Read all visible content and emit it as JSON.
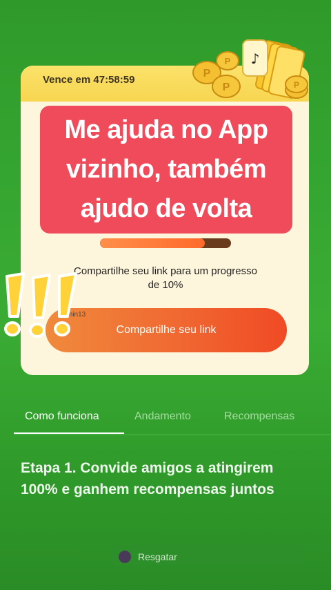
{
  "offer": {
    "countdown": "Vence em 47:58:59",
    "overlay_text": "Me ajuda no App vizinho, também ajudo de volta",
    "progress": 0.8,
    "share_desc": "Compartilhe seu link para um progresso de 10%",
    "share_button": "Compartilhe seu link",
    "user_tag": "smin13"
  },
  "tabs": [
    {
      "label": "Como funciona",
      "active": true
    },
    {
      "label": "Andamento",
      "active": false
    },
    {
      "label": "Recompensas",
      "active": false
    }
  ],
  "step": {
    "text": "Etapa 1. Convide amigos a atingirem 100% e ganhem recompensas juntos"
  },
  "redeem": {
    "label": "Resgatar"
  },
  "colors": {
    "background": "#35a531",
    "banner": "#ef4b5a",
    "button": "#f06832",
    "card": "#fdf6dd"
  }
}
